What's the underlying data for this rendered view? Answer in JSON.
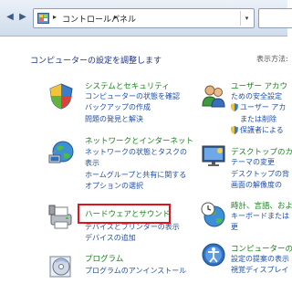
{
  "address_bar": {
    "back_icon": "back-arrow-icon",
    "forward_icon": "forward-arrow-icon",
    "breadcrumb": "コントロールパネル",
    "separator": "▸",
    "dropdown": "▾"
  },
  "content": {
    "heading": "コンピューターの設定を調整します",
    "view_by": "表示方法:"
  },
  "left_categories": [
    {
      "title": "システムとセキュリティ",
      "icon": "shield-icon",
      "links": [
        "コンピューターの状態を確認",
        "バックアップの作成",
        "問題の発見と解決"
      ]
    },
    {
      "title": "ネットワークとインターネット",
      "icon": "network-globe-icon",
      "links": [
        "ネットワークの状態とタスクの",
        "表示",
        "ホームグループと共有に関する",
        "オプションの選択"
      ]
    },
    {
      "title": "ハードウェアとサウンド",
      "icon": "printer-icon",
      "links": [
        "デバイスとプリンターの表示",
        "デバイスの追加"
      ]
    },
    {
      "title": "プログラム",
      "icon": "programs-disc-icon",
      "links": [
        "プログラムのアンインストール"
      ]
    }
  ],
  "right_categories": [
    {
      "title": "ユーザー アカウ",
      "icon": "users-icon",
      "links": [
        "ための安全設定",
        "ユーザー アカ",
        "または削除",
        "保護者による"
      ]
    },
    {
      "title": "デスクトップのカ",
      "icon": "desktop-appearance-icon",
      "links": [
        "テーマの変更",
        "デスクトップの背",
        "画面の解像度の"
      ]
    },
    {
      "title": "時計、言語、およ",
      "icon": "clock-globe-icon",
      "links": [
        "キーボードまたは",
        "更"
      ]
    },
    {
      "title": "コンピューターの",
      "icon": "ease-of-access-icon",
      "links": [
        "設定の提案の表示",
        "視覚ディスプレイ"
      ]
    }
  ],
  "colors": {
    "category_title": "#16861a",
    "link": "#1f4fa8",
    "heading": "#1e3287",
    "highlight_box": "#e0141e"
  }
}
